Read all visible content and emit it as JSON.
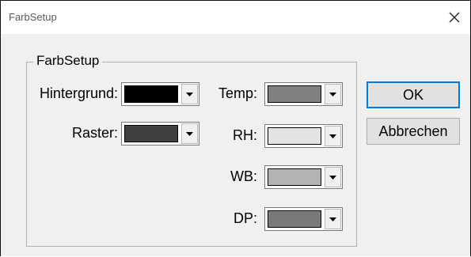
{
  "window": {
    "title": "FarbSetup",
    "close_icon": "close-icon"
  },
  "group": {
    "label": "FarbSetup"
  },
  "fields": [
    {
      "label": "Hintergrund:",
      "color": "#000000"
    },
    {
      "label": "Raster:",
      "color": "#404040"
    },
    {
      "label": "Temp:",
      "color": "#808080"
    },
    {
      "label": "RH:",
      "color": "#e3e3e3"
    },
    {
      "label": "WB:",
      "color": "#b3b3b3"
    },
    {
      "label": "DP:",
      "color": "#7a7a7a"
    }
  ],
  "buttons": {
    "ok": "OK",
    "cancel": "Abbrechen"
  }
}
